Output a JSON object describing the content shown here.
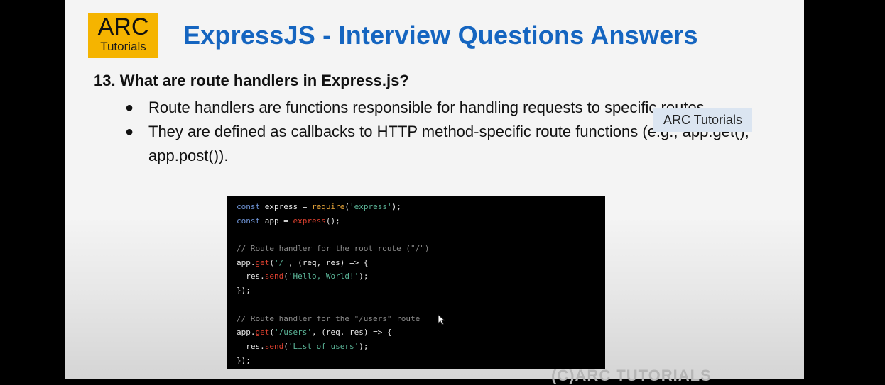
{
  "logo": {
    "main": "ARC",
    "sub": "Tutorials"
  },
  "title": "ExpressJS - Interview Questions Answers",
  "question": "13. What are route handlers in Express.js?",
  "bullets": [
    "Route handlers are functions responsible for handling requests to specific routes.",
    "They are defined as callbacks to HTTP method-specific route functions (e.g., app.get(), app.post())."
  ],
  "watermark_badge": "ARC Tutorials",
  "code": {
    "l1": {
      "a": "const",
      "b": " express = ",
      "c": "require",
      "d": "(",
      "e": "'express'",
      "f": ");"
    },
    "l2": {
      "a": "const",
      "b": " app = ",
      "c": "express",
      "d": "();"
    },
    "l4": "// Route handler for the root route (\"/\")",
    "l5": {
      "a": "app.",
      "b": "get",
      "c": "(",
      "d": "'/'",
      "e": ", (req, res) => {"
    },
    "l6": {
      "a": "  res.",
      "b": "send",
      "c": "(",
      "d": "'Hello, World!'",
      "e": ");"
    },
    "l7": "});",
    "l9": "// Route handler for the \"/users\" route",
    "l10": {
      "a": "app.",
      "b": "get",
      "c": "(",
      "d": "'/users'",
      "e": ", (req, res) => {"
    },
    "l11": {
      "a": "  res.",
      "b": "send",
      "c": "(",
      "d": "'List of users'",
      "e": ");"
    },
    "l12": "});"
  },
  "footer": "(C)ARC TUTORIALS",
  "colors": {
    "title": "#1565c0",
    "logo_bg": "#f5b400",
    "badge_bg": "#dbe5f1",
    "code_bg": "#000000"
  },
  "icons": {
    "cursor": "mouse-pointer-icon"
  }
}
